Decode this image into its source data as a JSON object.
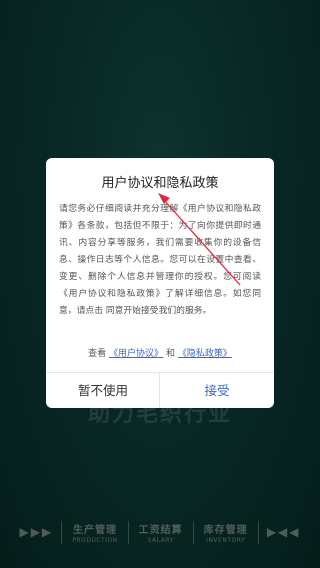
{
  "background": {
    "slogan": "助力毛织行业",
    "features": [
      {
        "cn": "生产管理",
        "en": "PRODUCTION"
      },
      {
        "cn": "工资结算",
        "en": "SALARY"
      },
      {
        "cn": "库存管理",
        "en": "INVENTORY"
      }
    ],
    "left_arrows": "▶▶▶",
    "right_arrows": "▶◀◀"
  },
  "dialog": {
    "title": "用户协议和隐私政策",
    "body": "请您务必仔细阅读并充分理解《用户协议和隐私政策》各条款，包括但不限于：为了向你提供即时通讯、内容分享等服务，我们需要收集你的设备信息、操作日志等个人信息。您可以在设置中查看、变更、删除个人信息并管理你的授权。您可阅读《用户协议和隐私政策》了解详细信息。如您同意，请点击 同意开始接受我们的服务。",
    "view_prefix": "查看",
    "link_terms": "《用户协议》",
    "and_text": "和",
    "link_privacy": "《隐私政策》",
    "decline_label": "暂不使用",
    "accept_label": "接受"
  },
  "colors": {
    "background": "#0f4a44",
    "link": "#3a68c8",
    "annotation_arrow": "#e0283c"
  }
}
